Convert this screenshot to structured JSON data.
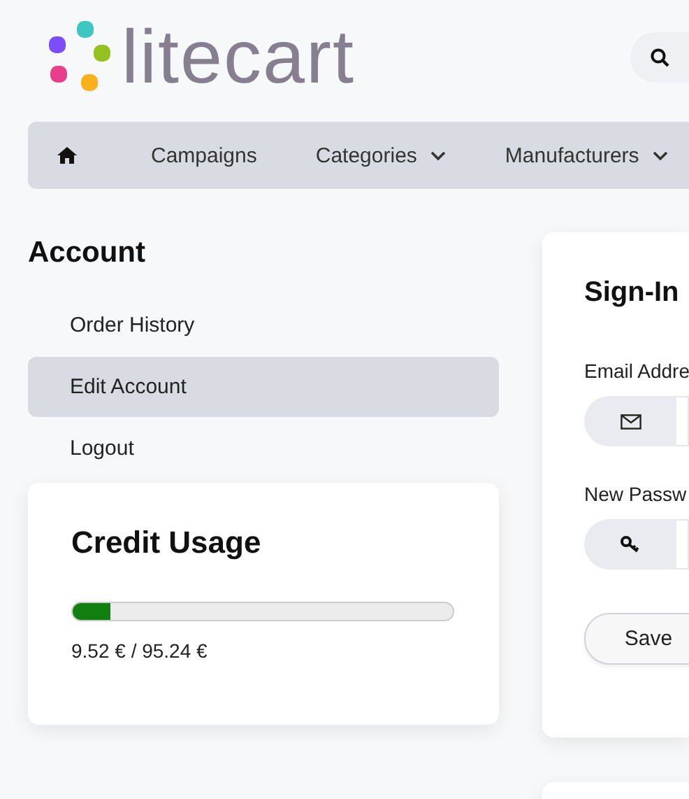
{
  "logo": {
    "text": "litecart"
  },
  "nav": {
    "items": [
      {
        "kind": "home"
      },
      {
        "kind": "link",
        "label": "Campaigns"
      },
      {
        "kind": "dropdown",
        "label": "Categories"
      },
      {
        "kind": "dropdown",
        "label": "Manufacturers"
      }
    ]
  },
  "account": {
    "title": "Account",
    "menu": [
      {
        "label": "Order History",
        "selected": false
      },
      {
        "label": "Edit Account",
        "selected": true
      },
      {
        "label": "Logout",
        "selected": false
      }
    ]
  },
  "credit": {
    "title": "Credit Usage",
    "level": 0.1,
    "reading": "9.52 € / 95.24 €"
  },
  "signin": {
    "title": "Sign-In",
    "fields": [
      {
        "label": "Email Addre",
        "kind": "email"
      },
      {
        "label": "New Passw",
        "kind": "password"
      }
    ],
    "button": "Save"
  }
}
